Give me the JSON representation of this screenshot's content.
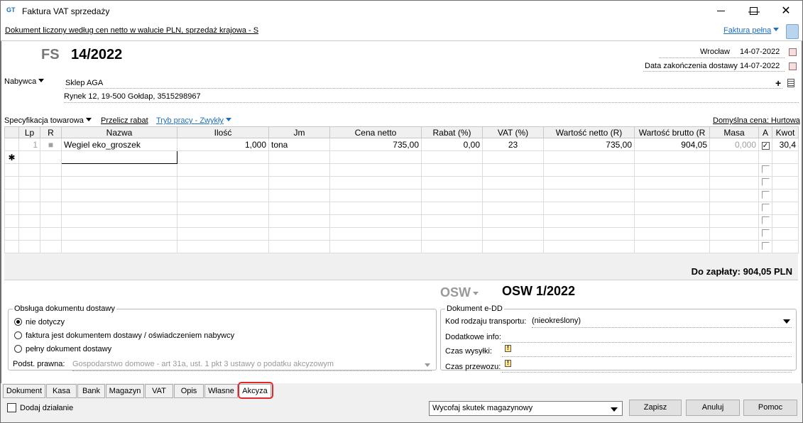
{
  "window": {
    "title": "Faktura VAT sprzedaży",
    "icon_text": "GT",
    "minimize": "—",
    "maximize": "☐",
    "close": "✕"
  },
  "info_bar": {
    "text": "Dokument liczony według cen netto w walucie PLN, sprzedaż krajowa - S",
    "mode_link": "Faktura pełna"
  },
  "header": {
    "doc_type": "FS",
    "doc_number": "14/2022",
    "place_label": "Wrocław",
    "place_date": "14-07-2022",
    "delivery_label": "Data zakończenia dostawy",
    "delivery_date": "14-07-2022"
  },
  "buyer": {
    "label": "Nabywca",
    "name": "Sklep AGA",
    "address": "Rynek 12, 19-500 Gołdap, 3515298967",
    "add_icon": "+",
    "list_icon": "list-icon"
  },
  "toolbar": {
    "spec": "Specyfikacja towarowa",
    "recalc": "Przelicz rabat",
    "mode": "Tryb pracy - Zwykły",
    "default_price": "Domyślna cena: Hurtowa"
  },
  "grid": {
    "columns": [
      "Lp",
      "R",
      "Nazwa",
      "Ilość",
      "Jm",
      "Cena netto",
      "Rabat (%)",
      "VAT (%)",
      "Wartość netto (R)",
      "Wartość brutto (R",
      "Masa",
      "A",
      "Kwot"
    ],
    "rows": [
      {
        "lp": "1",
        "r": "■",
        "name": "Wegiel eko_groszek",
        "qty": "1,000",
        "unit": "tona",
        "price": "735,00",
        "discount": "0,00",
        "vat": "23",
        "net": "735,00",
        "gross": "904,05",
        "mass": "0,000",
        "a_checked": "✓",
        "kwot": "30,4"
      }
    ],
    "new_row_marker": "✱"
  },
  "totals": {
    "to_pay": "Do zapłaty: 904,05 PLN"
  },
  "osw": {
    "label": "OSW",
    "number": "OSW 1/2022"
  },
  "delivery_doc": {
    "legend": "Obsługa dokumentu dostawy",
    "options": [
      "nie dotyczy",
      "faktura jest dokumentem dostawy / oświadczeniem nabywcy",
      "pełny dokument dostawy"
    ],
    "selected_index": 0,
    "legal_label": "Podst. prawna:",
    "legal_value": "Gospodarstwo domowe - art 31a, ust. 1 pkt 3 ustawy o podatku akcyzowym"
  },
  "edd": {
    "legend": "Dokument e-DD",
    "transport_label": "Kod rodzaju transportu:",
    "transport_value": "(nieokreślony)",
    "extra_label": "Dodatkowe info:",
    "send_time_label": "Czas wysyłki:",
    "transport_time_label": "Czas przewozu:",
    "warn_icon": "!"
  },
  "tabs": [
    "Dokument",
    "Kasa",
    "Bank",
    "Magazyn",
    "VAT",
    "Opis",
    "Własne",
    "Akcyza"
  ],
  "active_tab": "Akcyza",
  "bottom": {
    "add_action": "Dodaj działanie",
    "stock_action": "Wycofaj skutek magazynowy",
    "save": "Zapisz",
    "cancel": "Anuluj",
    "help": "Pomoc"
  }
}
